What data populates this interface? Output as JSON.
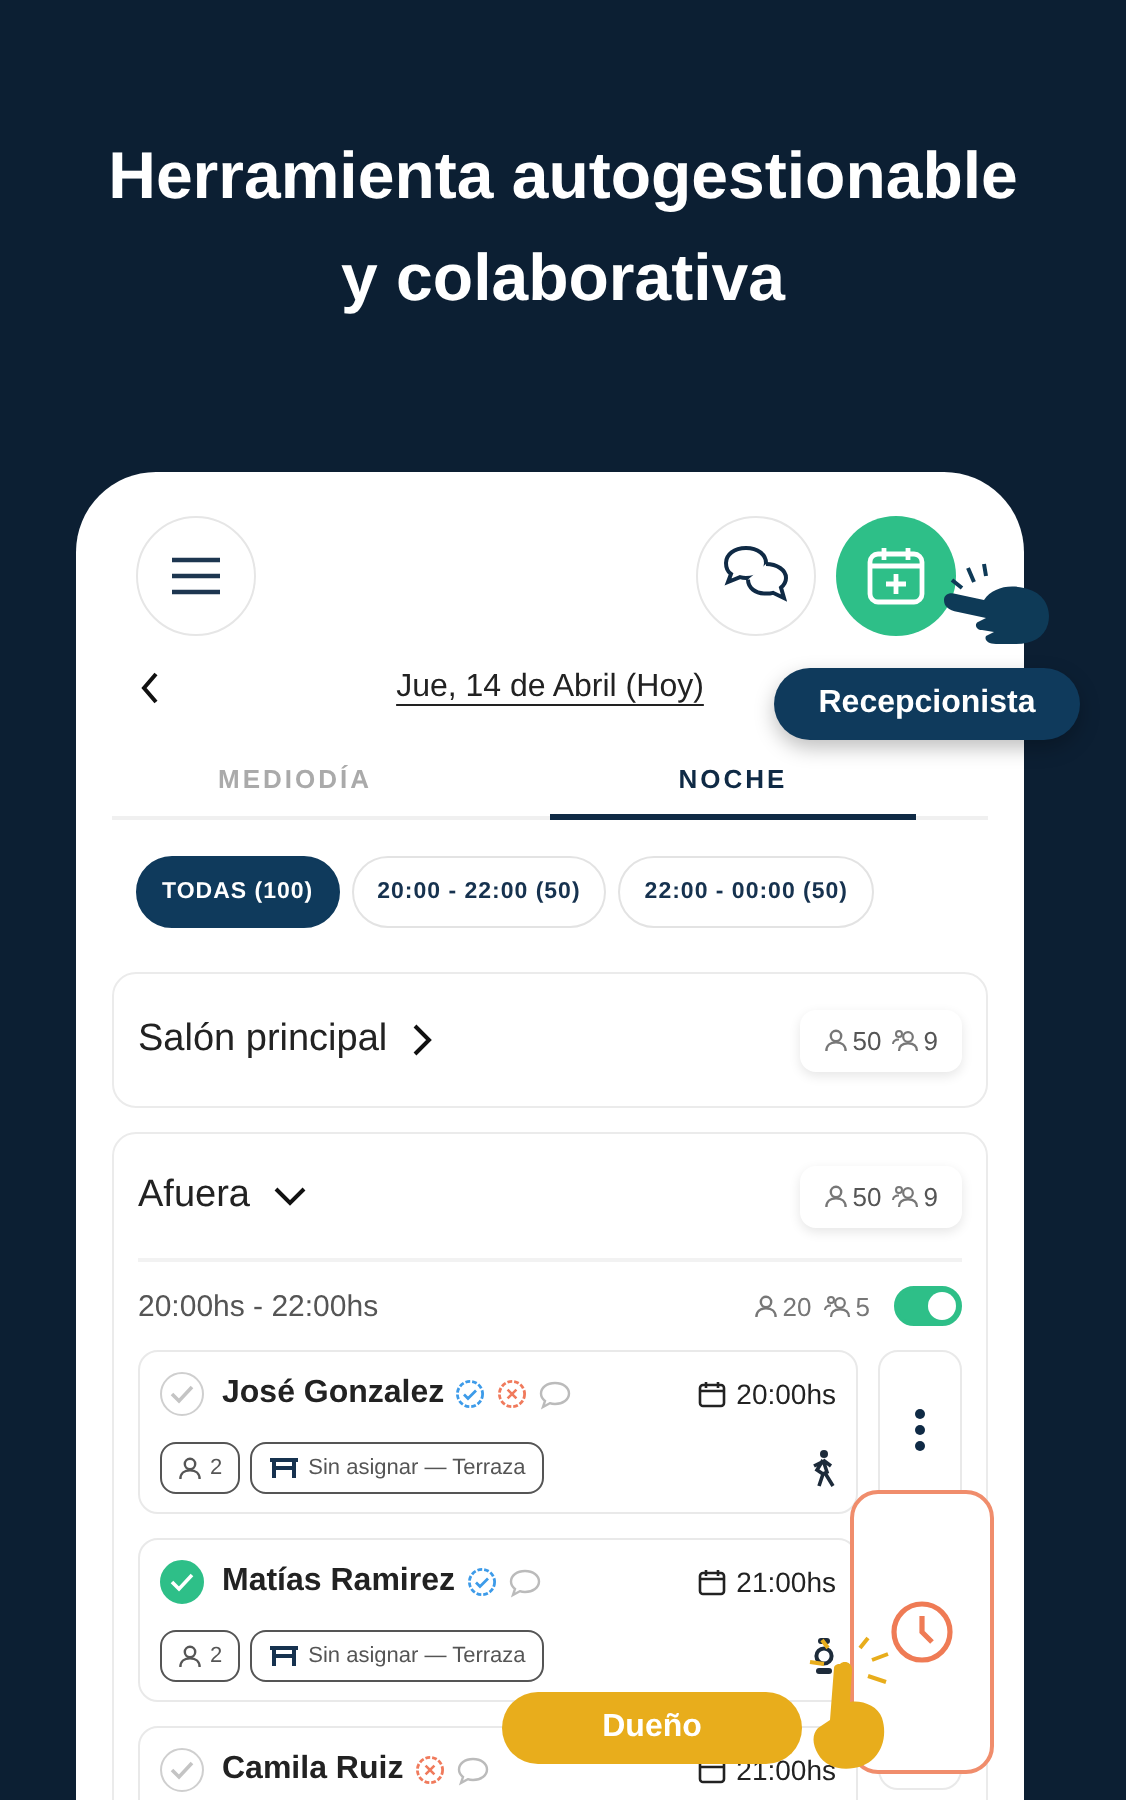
{
  "headline_lines": [
    "Herramienta autogestionable",
    "y colaborativa"
  ],
  "date": "Jue, 14 de Abril (Hoy)",
  "tabs": [
    {
      "label": "MEDIODÍA",
      "selected": false
    },
    {
      "label": "NOCHE",
      "selected": true
    }
  ],
  "filters": [
    {
      "label": "TODAS (100)",
      "selected": true
    },
    {
      "label": "20:00 - 22:00 (50)",
      "selected": false
    },
    {
      "label": "22:00 - 00:00 (50)",
      "selected": false
    }
  ],
  "areas": [
    {
      "name": "Salón principal",
      "expanded": false,
      "guests": "50",
      "tables": "9"
    },
    {
      "name": "Afuera",
      "expanded": true,
      "guests": "50",
      "tables": "9",
      "slots": [
        {
          "time": "20:00hs - 22:00hs",
          "guests": "20",
          "tables": "5",
          "on": true,
          "reservations": [
            {
              "name": "José Gonzalez",
              "checked": false,
              "badges": [
                {
                  "kind": "verified"
                },
                {
                  "kind": "alert"
                },
                {
                  "kind": "comment"
                }
              ],
              "time": "20:00hs",
              "party": "2",
              "table": "Sin asignar — Terraza",
              "kind": "walking"
            },
            {
              "name": "Matías Ramirez",
              "checked": true,
              "badges": [
                {
                  "kind": "verified"
                },
                {
                  "kind": "comment"
                }
              ],
              "time": "21:00hs",
              "party": "2",
              "table": "Sin asignar — Terraza",
              "kind": "seated"
            },
            {
              "name": "Camila Ruiz",
              "checked": false,
              "badges": [
                {
                  "kind": "alert"
                },
                {
                  "kind": "comment"
                }
              ],
              "time": "21:00hs"
            }
          ]
        }
      ]
    }
  ],
  "callouts": [
    {
      "kind": "receptionist",
      "label": "Recepcionista"
    },
    {
      "kind": "owner",
      "label": "Dueño"
    }
  ]
}
